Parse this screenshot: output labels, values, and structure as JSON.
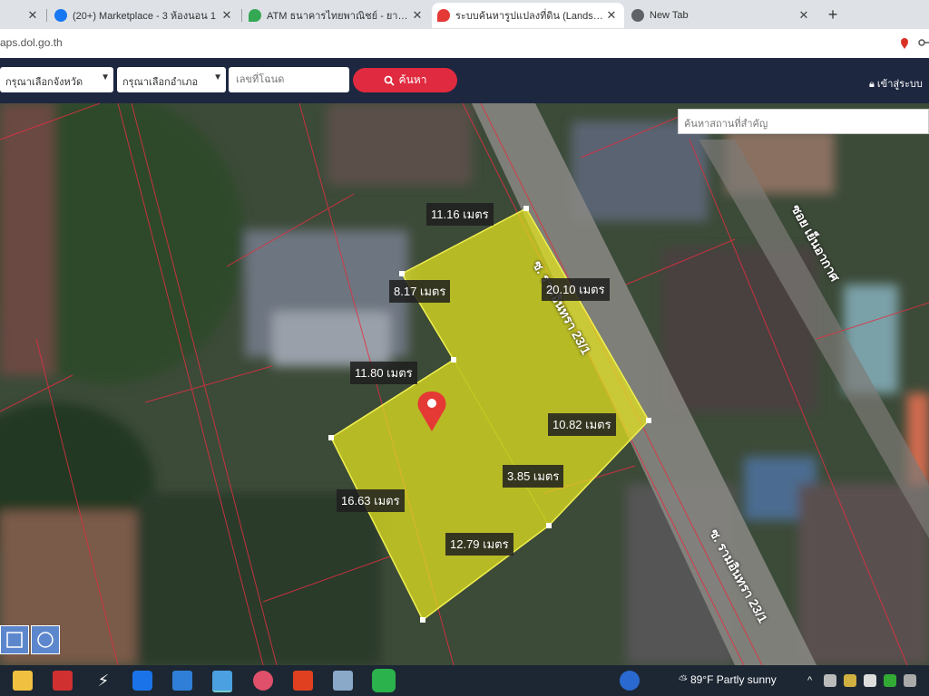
{
  "browser": {
    "tabs": [
      {
        "label": ""
      },
      {
        "label": "(20+) Marketplace - 3 ห้องนอน 1"
      },
      {
        "label": "ATM ธนาคารไทยพาณิชย์ - ยามาธาน"
      },
      {
        "label": "ระบบค้นหารูปแปลงที่ดิน (LandsMaps)"
      },
      {
        "label": "New Tab"
      }
    ],
    "new_tab": "+",
    "url": "aps.dol.go.th"
  },
  "site": {
    "province_select": "กรุณาเลือกจังหวัด",
    "district_select": "กรุณาเลือกอำเภอ",
    "parcel_placeholder": "เลขที่โฉนด",
    "search_label": "ค้นหา",
    "login_label": "เข้าสู่ระบบ",
    "place_search_placeholder": "ค้นหาสถานที่สำคัญ"
  },
  "map": {
    "parcel_color": "#e6e61e",
    "measurements": [
      "11.16 เมตร",
      "8.17 เมตร",
      "20.10 เมตร",
      "11.80 เมตร",
      "10.82 เมตร",
      "3.85 เมตร",
      "16.63 เมตร",
      "12.79 เมตร"
    ],
    "road_labels": [
      "ซ. รามอินทรา 23/1",
      "ซ. รามอินทรา 23/1",
      "ซอย เย็นอากาศ"
    ]
  },
  "taskbar": {
    "weather": "89°F  Partly sunny"
  }
}
